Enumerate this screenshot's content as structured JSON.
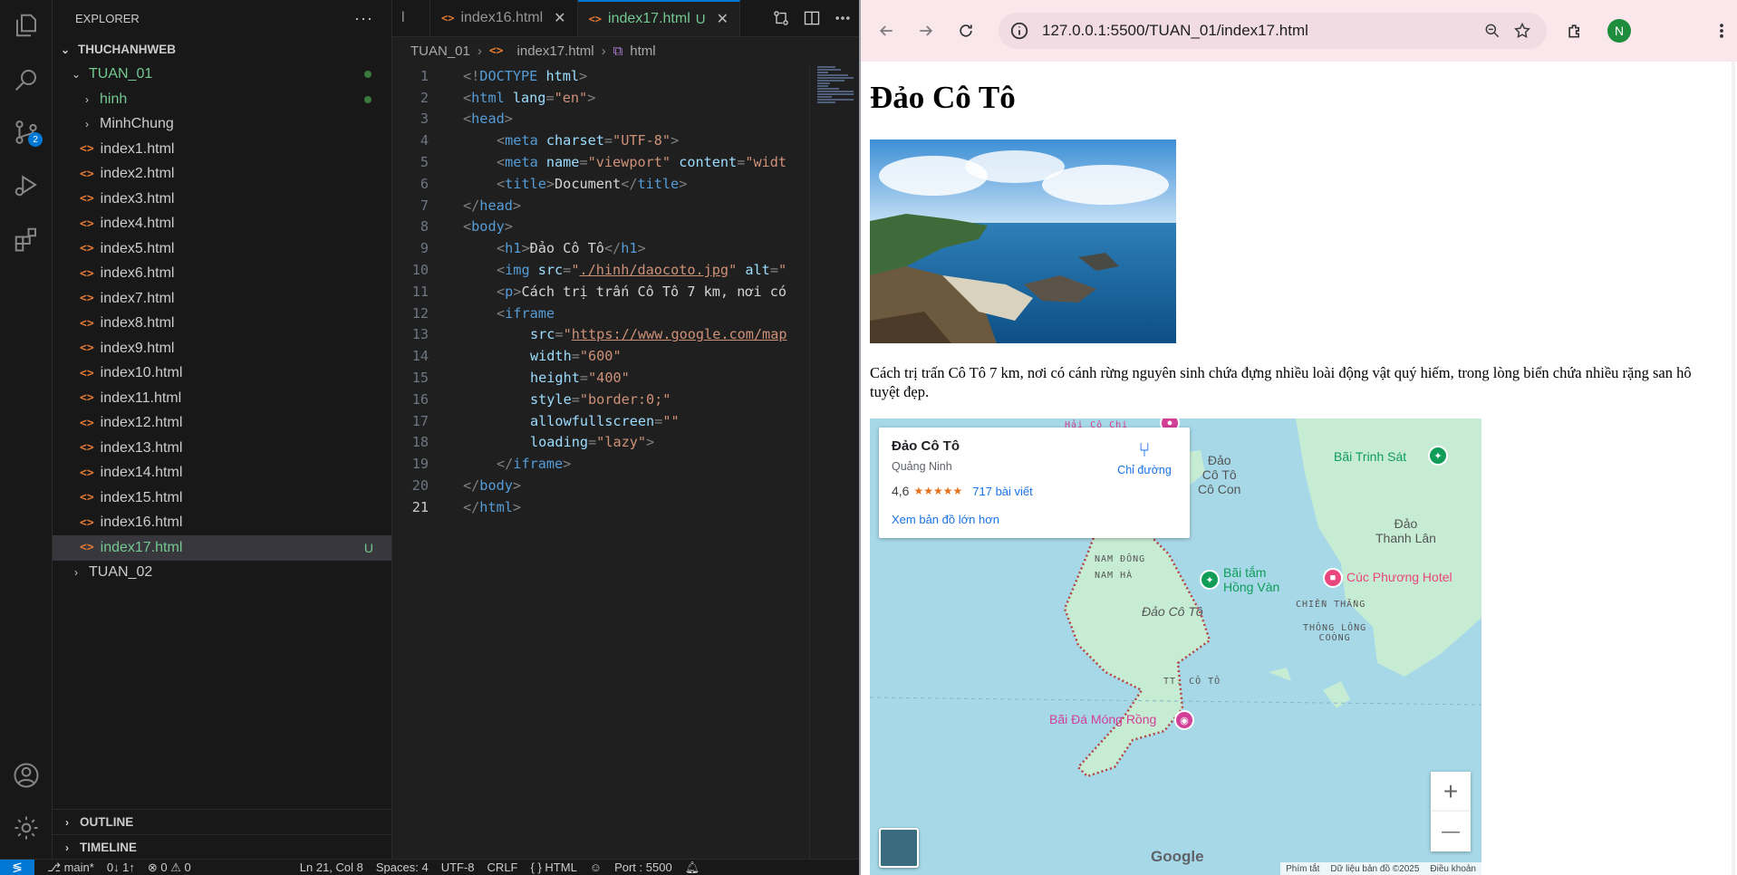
{
  "explorer": {
    "title": "EXPLORER",
    "root": "THUCHANHWEB",
    "tuan01": "TUAN_01",
    "folders": [
      "hinh",
      "MinhChung"
    ],
    "files": [
      "index1.html",
      "index2.html",
      "index3.html",
      "index4.html",
      "index5.html",
      "index6.html",
      "index7.html",
      "index8.html",
      "index9.html",
      "index10.html",
      "index11.html",
      "index12.html",
      "index13.html",
      "index14.html",
      "index15.html",
      "index16.html",
      "index17.html"
    ],
    "active_file_mark": "U",
    "tuan02": "TUAN_02",
    "outline": "OUTLINE",
    "timeline": "TIMELINE"
  },
  "activity": {
    "scm_badge": "2"
  },
  "tabs": {
    "partial": "l",
    "tab1": "index16.html",
    "tab2": "index17.html",
    "tab2_mark": "U"
  },
  "breadcrumb": {
    "folder": "TUAN_01",
    "file": "index17.html",
    "node": "html"
  },
  "code_line_numbers": [
    "1",
    "2",
    "3",
    "4",
    "5",
    "6",
    "7",
    "8",
    "9",
    "10",
    "11",
    "12",
    "13",
    "14",
    "15",
    "16",
    "17",
    "18",
    "19",
    "20",
    "21"
  ],
  "code": {
    "l1": [
      "<!",
      "DOCTYPE",
      " html",
      ">"
    ],
    "l2": [
      "<",
      "html",
      " lang",
      "=",
      "\"en\"",
      ">"
    ],
    "l3": [
      "<",
      "head",
      ">"
    ],
    "l4": [
      "<",
      "meta",
      " charset",
      "=",
      "\"UTF-8\"",
      ">"
    ],
    "l5": [
      "<",
      "meta",
      " name",
      "=",
      "\"viewport\"",
      " content",
      "=",
      "\"widt"
    ],
    "l6": [
      "<",
      "title",
      ">",
      "Document",
      "</",
      "title",
      ">"
    ],
    "l7": [
      "</",
      "head",
      ">"
    ],
    "l8": [
      "<",
      "body",
      ">"
    ],
    "l9": [
      "<",
      "h1",
      ">",
      "Đảo Cô Tô",
      "</",
      "h1",
      ">"
    ],
    "l10": [
      "<",
      "img",
      " src",
      "=",
      "\"",
      "./hinh/daocoto.jpg",
      "\"",
      " alt",
      "=",
      "\""
    ],
    "l11": [
      "<",
      "p",
      ">",
      "Cách trị trấn Cô Tô 7 km, nơi có"
    ],
    "l12": [
      "<",
      "iframe"
    ],
    "l13": [
      "src",
      "=",
      "\"",
      "https://www.google.com/map"
    ],
    "l14": [
      "width",
      "=",
      "\"600\""
    ],
    "l15": [
      "height",
      "=",
      "\"400\""
    ],
    "l16": [
      "style",
      "=",
      "\"border:0;\""
    ],
    "l17": [
      "allowfullscreen",
      "=",
      "\"\""
    ],
    "l18": [
      "loading",
      "=",
      "\"lazy\"",
      ">"
    ],
    "l19": [
      "</",
      "iframe",
      ">"
    ],
    "l20": [
      "</",
      "body",
      ">"
    ],
    "l21": [
      "</",
      "html",
      ">"
    ]
  },
  "statusbar": {
    "branch": "main*",
    "sync": "0↓ 1↑",
    "problems": "⊗ 0 ⚠ 0",
    "position": "Ln 21, Col 8",
    "spaces": "Spaces: 4",
    "encoding": "UTF-8",
    "eol": "CRLF",
    "language": "{ } HTML",
    "port": "Port : 5500"
  },
  "browser": {
    "url": "127.0.0.1:5500/TUAN_01/index17.html",
    "avatar": "N"
  },
  "page": {
    "heading": "Đảo Cô Tô",
    "paragraph": "Cách trị trấn Cô Tô 7 km, nơi có cánh rừng nguyên sinh chứa đựng nhiều loài động vật quý hiếm, trong lòng biển chứa nhiều rặng san hô tuyệt đẹp."
  },
  "map": {
    "place_name": "Đảo Cô Tô",
    "region": "Quảng Ninh",
    "rating": "4,6",
    "stars": "★★★★★",
    "reviews": "717 bài viết",
    "directions": "Chỉ đường",
    "larger_map": "Xem bản đồ lớn hơn",
    "labels": {
      "dao_co_to_con": "Đảo\nCô Tô\nCô Con",
      "bai_trinh_sat": "Bãi Trinh Sát",
      "dao_thanh_lan": "Đảo\nThanh Lân",
      "bai_tam_hong_van": "Bãi tắm\nHồng Vàn",
      "cuc_phuong_hotel": "Cúc Phương Hotel",
      "nam_dong": "NAM ĐÔNG",
      "nam_ha": "NAM HÀ",
      "dao_co_to": "Đảo Cô Tô",
      "chien_thang": "CHIẾN THẮNG",
      "thong_long_cong": "THÔNG LỒNG\nCOÒNG",
      "tt_co_to": "TT. CÔ TÔ",
      "bai_da_mong_rong": "Bãi Đá Móng Rồng",
      "top_partial": "Hải Cô Chi"
    },
    "google": "Google",
    "footer": [
      "Phím tắt",
      "Dữ liệu bản đồ ©2025",
      "Điều khoản"
    ],
    "zoom_in": "+",
    "zoom_out": "—"
  }
}
